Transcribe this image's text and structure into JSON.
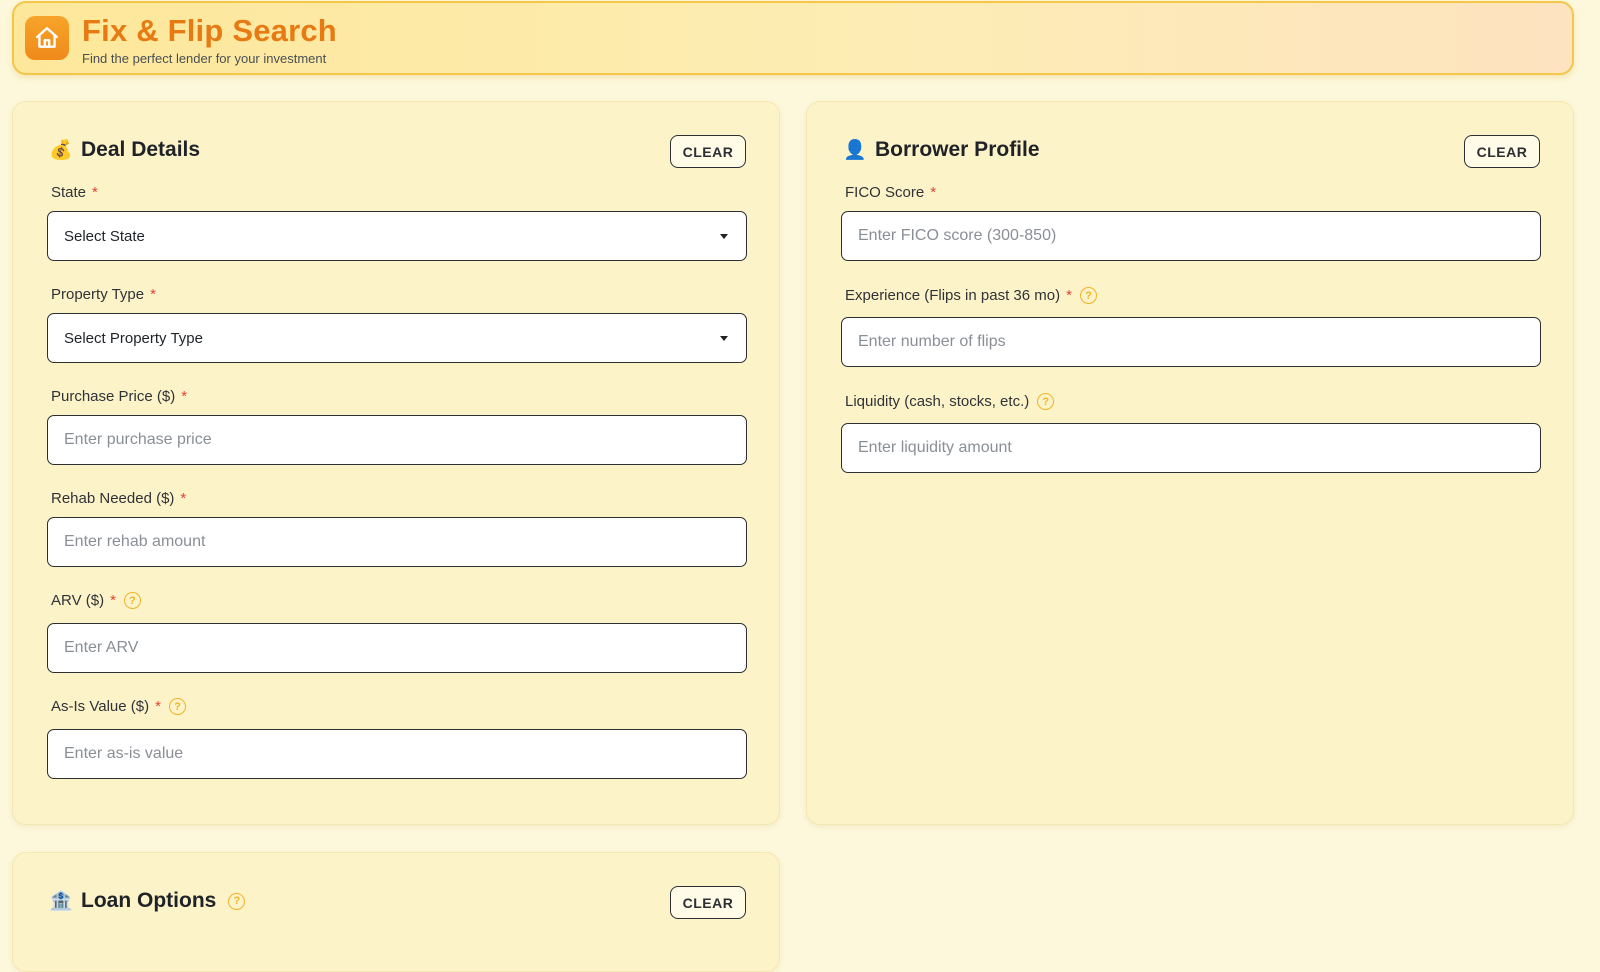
{
  "header": {
    "title": "Fix & Flip Search",
    "subtitle": "Find the perfect lender for your investment",
    "logo_icon": "home-icon"
  },
  "deal": {
    "title": "Deal Details",
    "emoji": "💰",
    "clear_label": "CLEAR",
    "state_label": "State",
    "state_value": "Select State",
    "property_label": "Property Type",
    "property_value": "Select Property Type",
    "purchase_label": "Purchase Price ($)",
    "purchase_placeholder": "Enter purchase price",
    "rehab_label": "Rehab Needed ($)",
    "rehab_placeholder": "Enter rehab amount",
    "arv_label": "ARV ($)",
    "arv_placeholder": "Enter ARV",
    "asis_label": "As-Is Value ($)",
    "asis_placeholder": "Enter as-is value"
  },
  "borrower": {
    "title": "Borrower Profile",
    "emoji": "👤",
    "clear_label": "CLEAR",
    "fico_label": "FICO Score",
    "fico_placeholder": "Enter FICO score (300-850)",
    "experience_label": "Experience (Flips in past 36 mo)",
    "experience_placeholder": "Enter number of flips",
    "liquidity_label": "Liquidity (cash, stocks, etc.)",
    "liquidity_placeholder": "Enter liquidity amount"
  },
  "loan": {
    "title": "Loan Options",
    "emoji": "🏦",
    "clear_label": "CLEAR"
  },
  "required_mark": "*",
  "help_mark": "?",
  "colors": {
    "accent": "#e77a12",
    "required": "#e0443a",
    "help": "#f0b429",
    "background": "#fdf8dc"
  }
}
